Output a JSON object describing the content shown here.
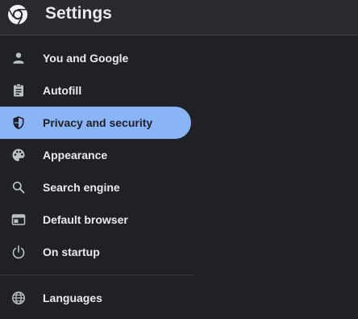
{
  "header": {
    "title": "Settings",
    "logo_icon": "chrome-logo-icon"
  },
  "colors": {
    "background": "#202124",
    "header_background": "#292a2d",
    "active_background": "#8ab4f8",
    "text": "#e8eaed",
    "icon": "#bdc1c6"
  },
  "sidebar": {
    "items": [
      {
        "label": "You and Google",
        "icon": "person-icon",
        "active": false
      },
      {
        "label": "Autofill",
        "icon": "clipboard-icon",
        "active": false
      },
      {
        "label": "Privacy and security",
        "icon": "shield-icon",
        "active": true
      },
      {
        "label": "Appearance",
        "icon": "palette-icon",
        "active": false
      },
      {
        "label": "Search engine",
        "icon": "search-icon",
        "active": false
      },
      {
        "label": "Default browser",
        "icon": "browser-window-icon",
        "active": false
      },
      {
        "label": "On startup",
        "icon": "power-icon",
        "active": false
      },
      {
        "label": "Languages",
        "icon": "globe-icon",
        "active": false
      }
    ]
  }
}
